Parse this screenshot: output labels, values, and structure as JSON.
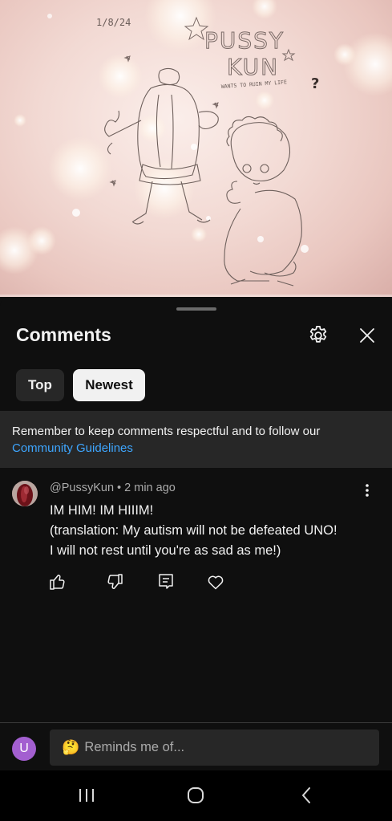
{
  "video": {
    "sketch_date": "1/8/24",
    "sketch_title_line1": "PUSSY",
    "sketch_title_line2": "KUN",
    "sketch_subtitle": "WANTS TO RUIN MY LIFE",
    "sketch_mark": "?",
    "progress": 0
  },
  "comments_panel": {
    "title": "Comments",
    "settings_icon": "gear-icon",
    "close_icon": "close-icon",
    "sort_chips": [
      {
        "label": "Top",
        "selected": false
      },
      {
        "label": "Newest",
        "selected": true
      }
    ],
    "notice": {
      "text": "Remember to keep comments respectful and to follow our",
      "link": "Community Guidelines"
    }
  },
  "comment": {
    "author": "@PussyKun",
    "separator": "•",
    "time": "2 min ago",
    "lines": [
      "IM HIM! IM HIIIM!",
      "(translation: My autism will not be defeated UNO!",
      "I will not rest until you're as sad as me!)"
    ],
    "actions": [
      "thumbs-up-icon",
      "thumbs-down-icon",
      "reply-icon",
      "heart-icon"
    ]
  },
  "composer": {
    "avatar_letter": "U",
    "avatar_color": "#a35fd0",
    "emoji": "🤔",
    "placeholder": "Reminds me of..."
  },
  "system_nav": {
    "icons": [
      "recent-apps-icon",
      "home-icon",
      "back-icon"
    ]
  },
  "colors": {
    "background": "#0f0f0f",
    "chip_dark": "#272727",
    "chip_light": "#f1f1f1",
    "link": "#3ea6ff",
    "secondary_text": "#aaaaaa"
  }
}
